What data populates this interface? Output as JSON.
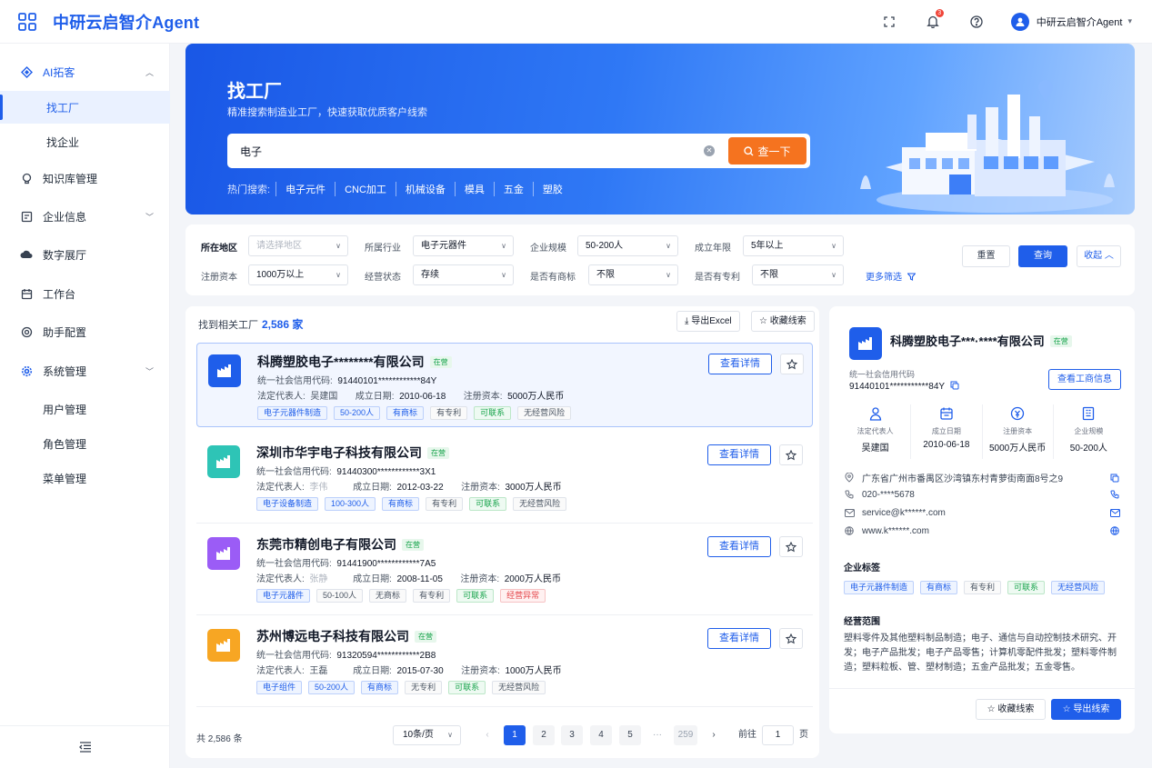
{
  "app": {
    "title": "中研云启智介Agent"
  },
  "topbar": {
    "notification_count": "3",
    "user_name": "中研云启智介Agent"
  },
  "sidebar": {
    "ai": "AI拓客",
    "sub_factory": "找工厂",
    "sub_company": "找企业",
    "knowledge": "知识库管理",
    "enterprise": "企业信息",
    "hall": "数字展厅",
    "workbench": "工作台",
    "assistant": "助手配置",
    "system": "系统管理",
    "users": "用户管理",
    "roles": "角色管理",
    "menus": "菜单管理"
  },
  "hero": {
    "title": "找工厂",
    "subtitle": "精准搜索制造业工厂，快速获取优质客户线索",
    "search_value": "电子",
    "search_button": "查一下",
    "hot_label": "热门搜索:",
    "hot_items": [
      "电子元件",
      "CNC加工",
      "机械设备",
      "模具",
      "五金",
      "塑胶"
    ]
  },
  "filters": {
    "region_label": "所在地区",
    "region_placeholder": "请选择地区",
    "industry_label": "所属行业",
    "industry_value": "电子元器件",
    "scale_label": "企业规模",
    "scale_value": "50-200人",
    "years_label": "成立年限",
    "years_value": "5年以上",
    "capital_label": "注册资本",
    "capital_value": "1000万以上",
    "status_label": "经营状态",
    "status_value": "存续",
    "trademark_label": "是否有商标",
    "trademark_value": "不限",
    "patent_label": "是否有专利",
    "patent_value": "不限",
    "more": "更多筛选",
    "reset": "重置",
    "query": "查询",
    "collapse": "收起"
  },
  "results": {
    "label": "找到相关工厂",
    "count": "2,586 家",
    "export_excel": "导出Excel",
    "fav_leads": "收藏线索",
    "detail_btn": "查看详情",
    "credit_label": "统一社会信用代码:",
    "legal_label": "法定代表人:",
    "date_label": "成立日期:",
    "capital_label": "注册资本:",
    "items": [
      {
        "name": "科腾塑胶电子********有限公司",
        "status": "在营",
        "credit": "91440101************84Y",
        "legal": "吴建国",
        "date": "2010-06-18",
        "capital": "5000万人民币",
        "tags": [
          "电子元器件制造",
          "50-200人",
          "有商标",
          "有专利",
          "可联系",
          "无经营风险"
        ]
      },
      {
        "name": "深圳市华宇电子科技有限公司",
        "status": "在营",
        "credit": "91440300************3X1",
        "legal": "李伟",
        "date": "2012-03-22",
        "capital": "3000万人民币",
        "tags": [
          "电子设备制造",
          "100-300人",
          "有商标",
          "有专利",
          "可联系",
          "无经营风险"
        ]
      },
      {
        "name": "东莞市精创电子有限公司",
        "status": "在营",
        "credit": "91441900************7A5",
        "legal": "张静",
        "date": "2008-11-05",
        "capital": "2000万人民币",
        "tags": [
          "电子元器件",
          "50-100人",
          "无商标",
          "有专利",
          "可联系",
          "经营异常"
        ]
      },
      {
        "name": "苏州博远电子科技有限公司",
        "status": "在营",
        "credit": "91320594************2B8",
        "legal": "王磊",
        "date": "2015-07-30",
        "capital": "1000万人民币",
        "tags": [
          "电子组件",
          "50-200人",
          "有商标",
          "无专利",
          "可联系",
          "无经营风险"
        ]
      }
    ],
    "pager": {
      "total": "共 2,586 条",
      "page_size": "10条/页",
      "pages": [
        "1",
        "2",
        "3",
        "4",
        "5"
      ],
      "dots": "···",
      "last": "259",
      "goto": "前往",
      "goto_value": "1",
      "page_unit": "页"
    }
  },
  "detail": {
    "name": "科腾塑胶电子***·****有限公司",
    "status": "在营",
    "credit_label": "统一社会信用代码",
    "credit": "91440101***********84Y",
    "biz_btn": "查看工商信息",
    "stats": [
      {
        "label": "法定代表人",
        "value": "吴建国"
      },
      {
        "label": "成立日期",
        "value": "2010-06-18"
      },
      {
        "label": "注册资本",
        "value": "5000万人民币"
      },
      {
        "label": "企业规模",
        "value": "50-200人"
      }
    ],
    "address": "广东省广州市番禺区沙湾镇东村青萝街南面8号之9",
    "phone": "020-****5678",
    "email": "service@k******.com",
    "website": "www.k******.com",
    "tags_title": "企业标签",
    "tags": [
      "电子元器件制造",
      "有商标",
      "有专利",
      "可联系",
      "无经营风险"
    ],
    "scope_title": "经营范围",
    "scope": "塑料零件及其他塑料制品制造；电子、通信与自动控制技术研究、开发；电子产品批发；电子产品零售；计算机零配件批发；塑料零件制造；塑料粒板、管、塑材制造；五金产品批发；五金零售。",
    "fav": "收藏线索",
    "export": "导出线索"
  },
  "colors": {
    "accent": "#1f5eea",
    "orange": "#f5731f"
  }
}
